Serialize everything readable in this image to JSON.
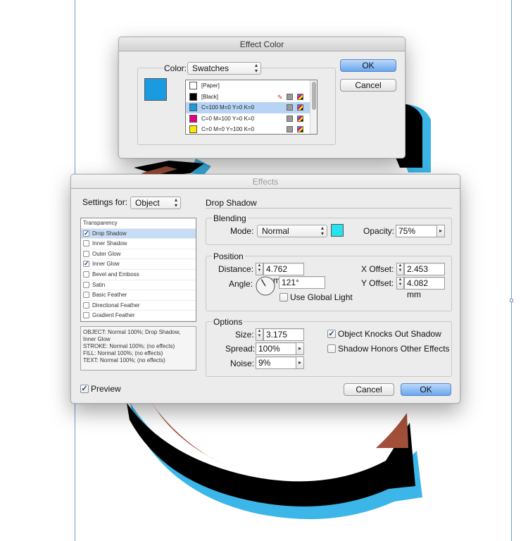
{
  "colors": {
    "canvas_blue": "#3cb6e8",
    "canvas_brown": "#a24f3a",
    "canvas_black": "#000000",
    "swatch_cyan": "#1a9be0",
    "shadow_blend_color": "#27e3ee",
    "button_default": "#6aa6ee"
  },
  "effect_color": {
    "title": "Effect Color",
    "color_label": "Color:",
    "color_source": "Swatches",
    "ok_label": "OK",
    "cancel_label": "Cancel",
    "swatches": [
      {
        "name": "[Paper]",
        "color": "#ffffff",
        "icons": []
      },
      {
        "name": "[Black]",
        "color": "#000000",
        "icons": [
          "no-edit-icon",
          "gray-icon",
          "cmyk-icon"
        ]
      },
      {
        "name": "C=100 M=0 Y=0 K=0",
        "color": "#1a9be0",
        "icons": [
          "gray-icon",
          "cmyk-icon"
        ],
        "selected": true
      },
      {
        "name": "C=0 M=100 Y=0 K=0",
        "color": "#e5007e",
        "icons": [
          "gray-icon",
          "cmyk-icon"
        ]
      },
      {
        "name": "C=0 M=0 Y=100 K=0",
        "color": "#ffe800",
        "icons": [
          "gray-icon",
          "cmyk-icon"
        ]
      }
    ]
  },
  "effects": {
    "title": "Effects",
    "settings_for_label": "Settings for:",
    "settings_for_value": "Object",
    "section_title": "Drop Shadow",
    "effect_list": [
      {
        "label": "Transparency",
        "header": true
      },
      {
        "label": "Drop Shadow",
        "checked": true,
        "selected": true
      },
      {
        "label": "Inner Shadow",
        "checked": false
      },
      {
        "label": "Outer Glow",
        "checked": false
      },
      {
        "label": "Inner Glow",
        "checked": true
      },
      {
        "label": "Bevel and Emboss",
        "checked": false
      },
      {
        "label": "Satin",
        "checked": false
      },
      {
        "label": "Basic Feather",
        "checked": false
      },
      {
        "label": "Directional Feather",
        "checked": false
      },
      {
        "label": "Gradient Feather",
        "checked": false
      }
    ],
    "summary": [
      "OBJECT: Normal 100%; Drop Shadow, Inner Glow",
      "STROKE: Normal 100%; (no effects)",
      "FILL: Normal 100%; (no effects)",
      "TEXT: Normal 100%; (no effects)"
    ],
    "blending": {
      "group_label": "Blending",
      "mode_label": "Mode:",
      "mode_value": "Normal",
      "opacity_label": "Opacity:",
      "opacity_value": "75%"
    },
    "position": {
      "group_label": "Position",
      "distance_label": "Distance:",
      "distance_value": "4.762 mm",
      "angle_label": "Angle:",
      "angle_value": "121°",
      "angle_degrees": 121,
      "global_light_label": "Use Global Light",
      "global_light_checked": false,
      "x_offset_label": "X Offset:",
      "x_offset_value": "2.453 mm",
      "y_offset_label": "Y Offset:",
      "y_offset_value": "4.082 mm"
    },
    "options": {
      "group_label": "Options",
      "size_label": "Size:",
      "size_value": "3.175 mm",
      "spread_label": "Spread:",
      "spread_value": "100%",
      "noise_label": "Noise:",
      "noise_value": "9%",
      "knocks_out_label": "Object Knocks Out Shadow",
      "knocks_out_checked": true,
      "honors_label": "Shadow Honors Other Effects",
      "honors_checked": false
    },
    "preview_label": "Preview",
    "preview_checked": true,
    "cancel_label": "Cancel",
    "ok_label": "OK"
  }
}
